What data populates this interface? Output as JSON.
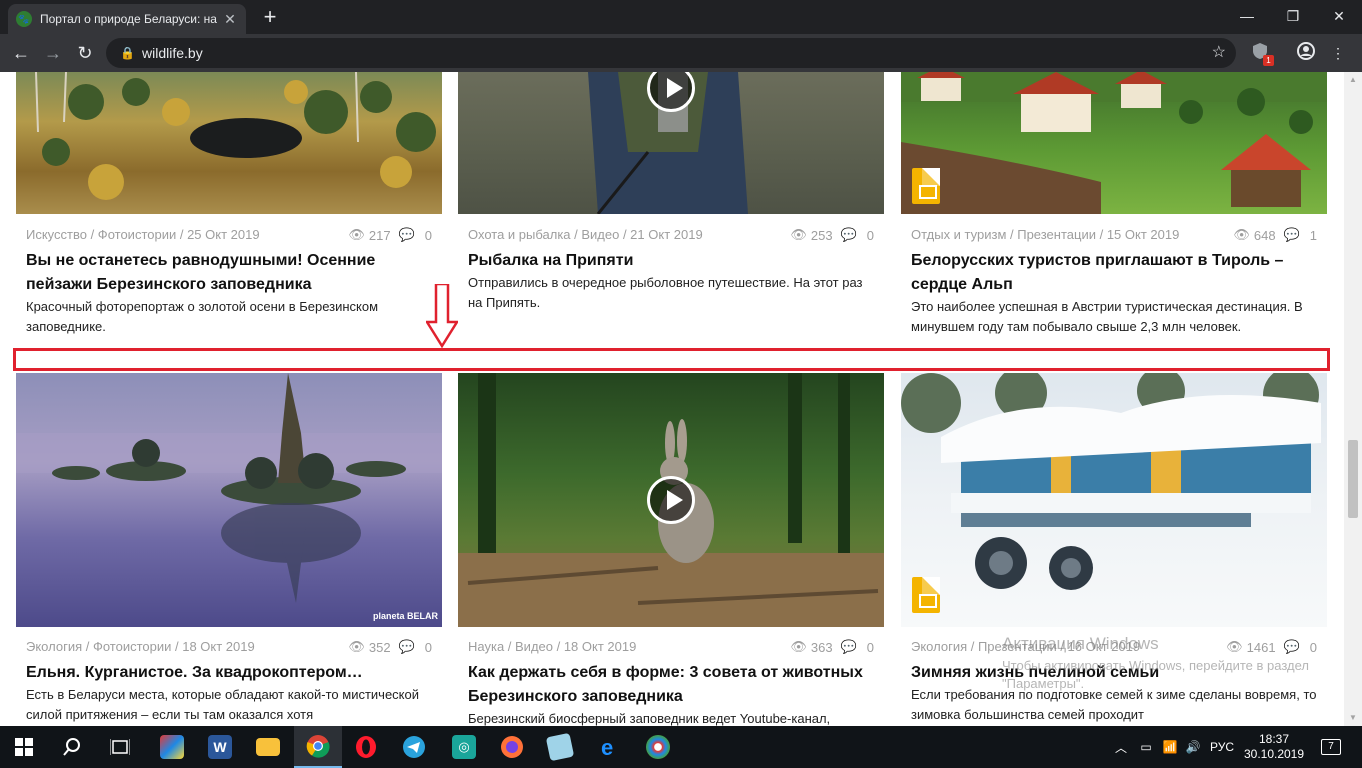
{
  "browser": {
    "tab_title": "Портал о природе Беларуси: на",
    "url": "wildlife.by",
    "ext_badge": "1",
    "new_tab": "+",
    "minimize": "—",
    "maximize": "❐",
    "close": "✕"
  },
  "cards_top": [
    {
      "category": "Искусство / Фотоистории / 25 Окт 2019",
      "views": "217",
      "comments": "0",
      "title": "Вы не останетесь равнодушными! Осенние пейзажи Березинского заповедника",
      "desc": "Красочный фоторепортаж о золотой осени в Березинском заповеднике."
    },
    {
      "category": "Охота и рыбалка / Видео / 21 Окт 2019",
      "views": "253",
      "comments": "0",
      "title": "Рыбалка на Припяти",
      "desc": "Отправились в очередное рыболовное путешествие. На этот раз на Припять."
    },
    {
      "category": "Отдых и туризм / Презентации / 15 Окт 2019",
      "views": "648",
      "comments": "1",
      "title": "Белорусских туристов приглашают в Тироль – сердце Альп",
      "desc": "Это наиболее успешная в Австрии туристическая дестинация. В минувшем году там побывало свыше 2,3 млн человек."
    }
  ],
  "cards_bottom": [
    {
      "category": "Экология / Фотоистории / 18 Окт 2019",
      "views": "352",
      "comments": "0",
      "title": "Ельня. Курганистое. За квадрокоптером…",
      "desc": "Есть в Беларуси места, которые обладают какой-то мистической силой притяжения – если ты там оказался хотя",
      "watermark": "planeta BELAR"
    },
    {
      "category": "Наука / Видео / 18 Окт 2019",
      "views": "363",
      "comments": "0",
      "title": "Как держать себя в форме: 3 совета от животных Березинского заповедника",
      "desc": "Березинский биосферный заповедник ведет Youtube-канал,"
    },
    {
      "category": "Экология / Презентации / 16 Окт 2019",
      "views": "1461",
      "comments": "0",
      "title": "Зимняя жизнь пчелиной семьи",
      "desc": "Если требования по подготовке семей к зиме сделаны вовремя, то зимовка большинства семей проходит"
    }
  ],
  "windows_activation": {
    "title": "Активация Windows",
    "text": "Чтобы активировать Windows, перейдите в раздел \"Параметры\"."
  },
  "taskbar": {
    "lang": "РУС",
    "time": "18:37",
    "date": "30.10.2019",
    "notifications": "7"
  }
}
